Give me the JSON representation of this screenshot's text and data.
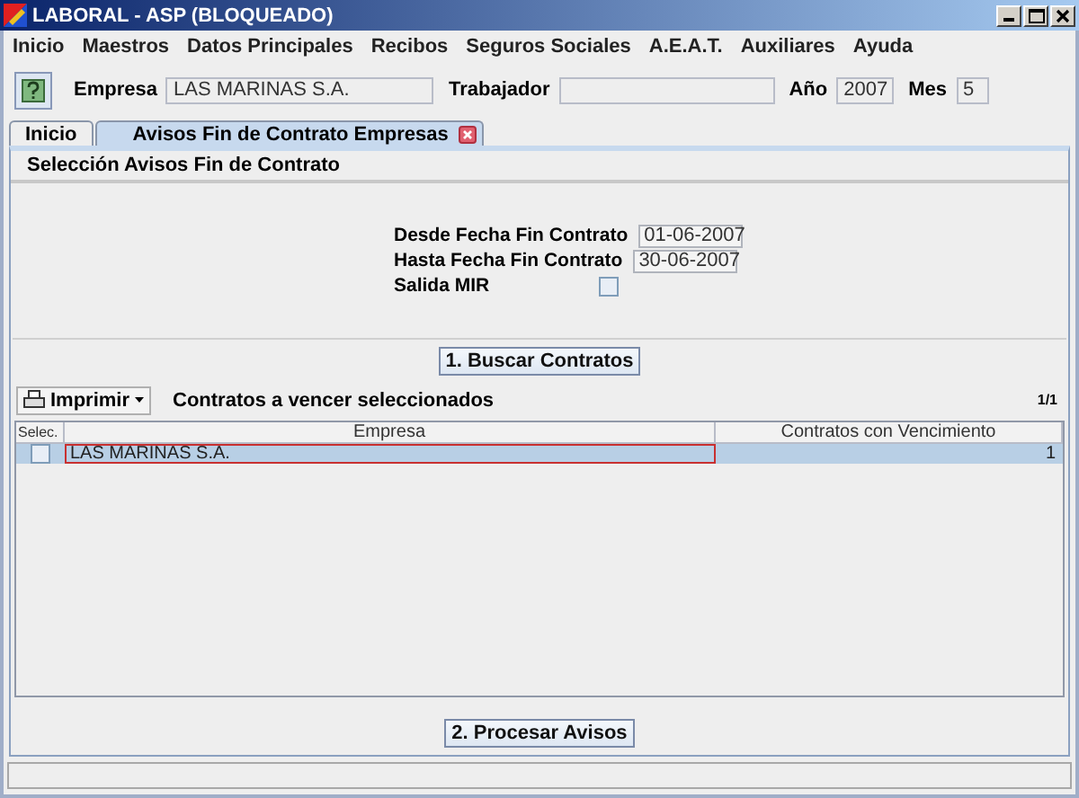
{
  "window": {
    "title": "LABORAL - ASP (BLOQUEADO)"
  },
  "menu": [
    "Inicio",
    "Maestros",
    "Datos Principales",
    "Recibos",
    "Seguros Sociales",
    "A.E.A.T.",
    "Auxiliares",
    "Ayuda"
  ],
  "header": {
    "fields": [
      {
        "label": "Empresa",
        "value": "LAS MARINAS S.A."
      },
      {
        "label": "Trabajador"
      },
      {
        "label": "Año",
        "value": "2007"
      },
      {
        "label": "Mes",
        "value": "5"
      }
    ]
  },
  "tabs": [
    {
      "label": "Inicio",
      "selected": false,
      "closable": false
    },
    {
      "label": "Avisos Fin de Contrato Empresas",
      "selected": true,
      "closable": true
    }
  ],
  "section": {
    "title": "Selección Avisos Fin de Contrato",
    "fields": [
      {
        "kind": "text",
        "label": "Desde Fecha Fin Contrato",
        "value": "01-06-2007"
      },
      {
        "kind": "text",
        "label": "Hasta Fecha Fin Contrato",
        "value": "30-06-2007"
      },
      {
        "kind": "checkbox",
        "label": "Salida MIR",
        "checked": false
      }
    ],
    "button": "1. Buscar Contratos"
  },
  "toolbar": {
    "print_button": "Imprimir",
    "title": "Contratos a vencer seleccionados",
    "page": "1/1"
  },
  "table": {
    "columns": [
      "Selec.",
      "Empresa",
      "Contratos con Vencimiento"
    ],
    "rows": [
      {
        "checked": false,
        "selected": true,
        "cells": [
          "LAS MARINAS S.A.",
          "1"
        ]
      }
    ]
  },
  "process_button": "2. Procesar Avisos"
}
